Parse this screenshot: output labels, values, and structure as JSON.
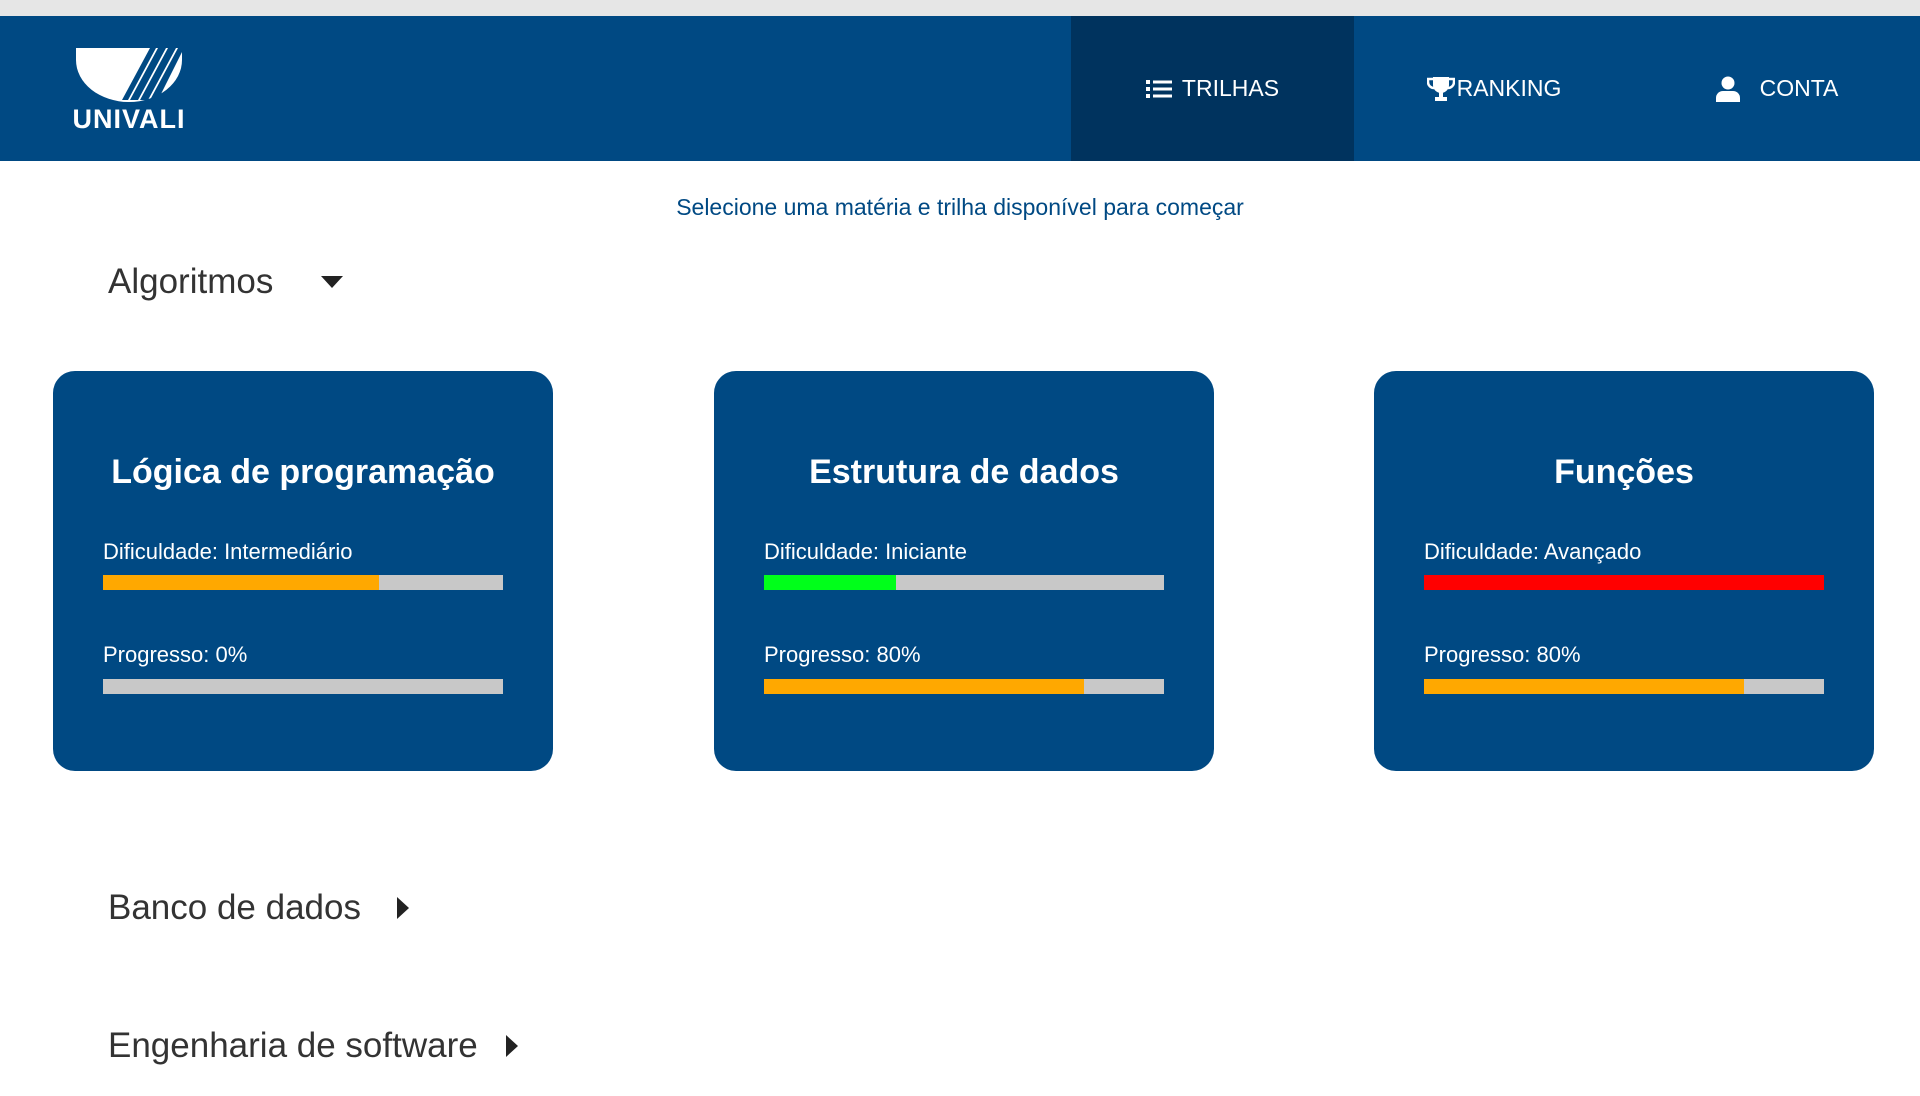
{
  "brand": {
    "name": "UNIVALI"
  },
  "nav": {
    "items": [
      {
        "label": "TRILHAS",
        "icon": "list-icon",
        "active": true
      },
      {
        "label": "RANKING",
        "icon": "trophy-icon",
        "active": false
      },
      {
        "label": "CONTA",
        "icon": "user-icon",
        "active": false
      }
    ]
  },
  "main": {
    "subtitle": "Selecione uma matéria e trilha disponível para começar",
    "subjects": [
      {
        "name": "Algoritmos",
        "expanded": true,
        "arrow_icon": "caret-down-icon"
      },
      {
        "name": "Banco de dados",
        "expanded": false,
        "arrow_icon": "caret-right-icon"
      },
      {
        "name": "Engenharia de software",
        "expanded": false,
        "arrow_icon": "caret-right-icon"
      }
    ],
    "tracks": [
      {
        "title": "Lógica de programação",
        "difficulty_label": "Dificuldade: Intermediário",
        "difficulty_level": 0.69,
        "difficulty_color": "#ffa800",
        "progress_label": "Progresso: 0%",
        "progress_value": 0,
        "progress_color": "#ffa800"
      },
      {
        "title": "Estrutura de dados",
        "difficulty_label": "Dificuldade: Iniciante",
        "difficulty_level": 0.33,
        "difficulty_color": "#00ff1a",
        "progress_label": "Progresso: 80%",
        "progress_value": 0.8,
        "progress_color": "#ffa800"
      },
      {
        "title": "Funções",
        "difficulty_label": "Dificuldade: Avançado",
        "difficulty_level": 1.0,
        "difficulty_color": "#ff0000",
        "progress_label": "Progresso: 80%",
        "progress_value": 0.8,
        "progress_color": "#ffa800"
      }
    ]
  },
  "colors": {
    "primary": "#004983",
    "primary_dark": "#00335e",
    "bar_track": "#c8c8c8"
  }
}
